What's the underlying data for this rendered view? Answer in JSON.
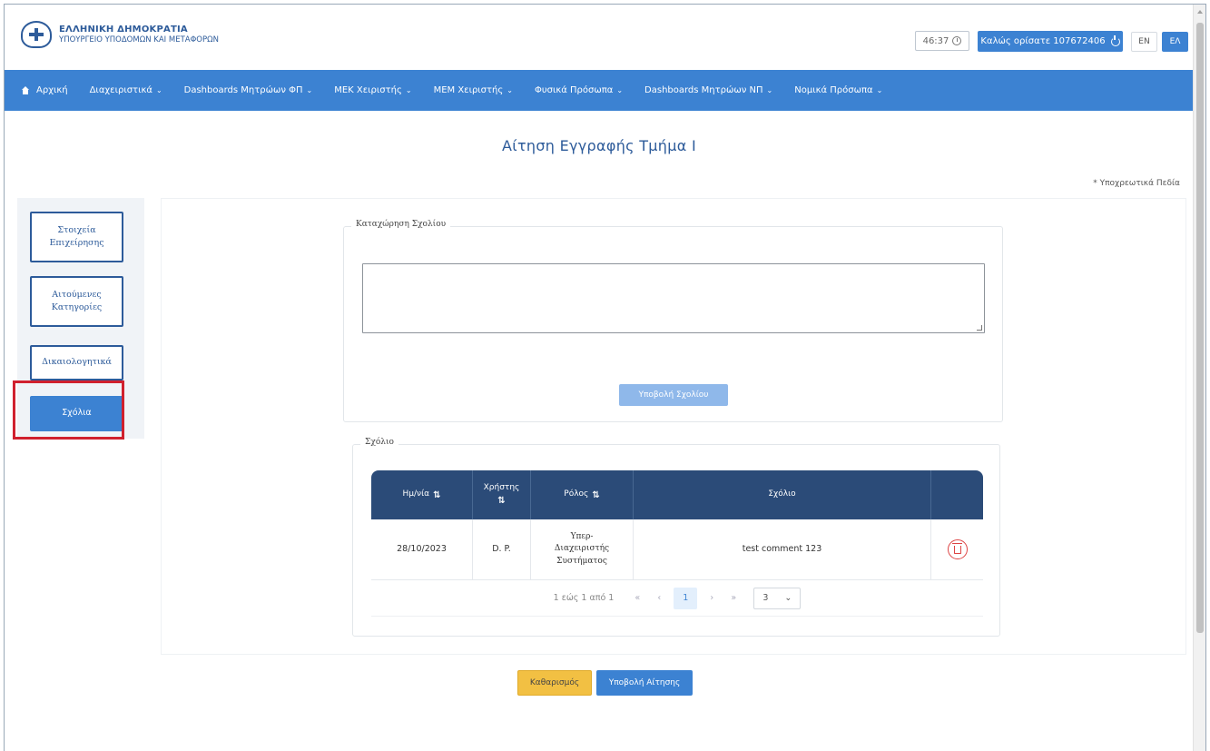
{
  "header": {
    "org_line1": "ΕΛΛΗΝΙΚΗ ΔΗΜΟΚΡΑΤΙΑ",
    "org_line2": "ΥΠΟΥΡΓΕΙΟ ΥΠΟΔΟΜΩΝ ΚΑΙ ΜΕΤΑΦΟΡΩΝ",
    "timer": "46:37",
    "welcome": "Καλώς ορίσατε 107672406",
    "lang_en": "EN",
    "lang_el": "ΕΛ"
  },
  "nav": {
    "items": [
      {
        "label": "Αρχική",
        "icon": "home-icon",
        "dropdown": false
      },
      {
        "label": "Διαχειριστικά",
        "dropdown": true
      },
      {
        "label": "Dashboards Μητρώων ΦΠ",
        "dropdown": true
      },
      {
        "label": "ΜΕΚ Χειριστής",
        "dropdown": true
      },
      {
        "label": "ΜΕΜ Χειριστής",
        "dropdown": true
      },
      {
        "label": "Φυσικά Πρόσωπα",
        "dropdown": true
      },
      {
        "label": "Dashboards Μητρώων ΝΠ",
        "dropdown": true
      },
      {
        "label": "Νομικά Πρόσωπα",
        "dropdown": true
      }
    ],
    "chevron": "⌄"
  },
  "page": {
    "title": "Αίτηση Εγγραφής Τμήμα Ι",
    "required_note": "* Υποχρεωτικά Πεδία"
  },
  "sidebar": {
    "items": [
      {
        "label": "Στοιχεία Επιχείρησης",
        "active": false
      },
      {
        "label": "Αιτούμενες Κατηγορίες",
        "active": false
      },
      {
        "label": "Δικαιολογητικά",
        "active": false
      },
      {
        "label": "Σχόλια",
        "active": true
      }
    ]
  },
  "comment_form": {
    "legend": "Καταχώρηση Σχολίου",
    "textarea_value": "",
    "submit_label": "Υποβολή Σχολίου"
  },
  "comments_table": {
    "legend": "Σχόλιο",
    "headers": {
      "date": "Ημ/νία",
      "user": "Χρήστης",
      "role": "Ρόλος",
      "comment": "Σχόλιο",
      "sort_icon": "⇅"
    },
    "rows": [
      {
        "date": "28/10/2023",
        "user": "D. P.",
        "role": "Υπερ-Διαχειριστής Συστήματος",
        "comment": "test comment 123"
      }
    ],
    "paginator": {
      "info": "1 εώς 1 από 1",
      "first": "«",
      "prev": "‹",
      "current": "1",
      "next": "›",
      "last": "»",
      "page_size": "3",
      "page_size_chevron": "⌄"
    }
  },
  "actions": {
    "clear_label": "Καθαρισμός",
    "submit_label": "Υποβολή Αίτησης"
  },
  "colors": {
    "primary": "#3c82d2",
    "table_header": "#2b4b78",
    "warning": "#f2c043",
    "highlight": "#d0202e"
  }
}
